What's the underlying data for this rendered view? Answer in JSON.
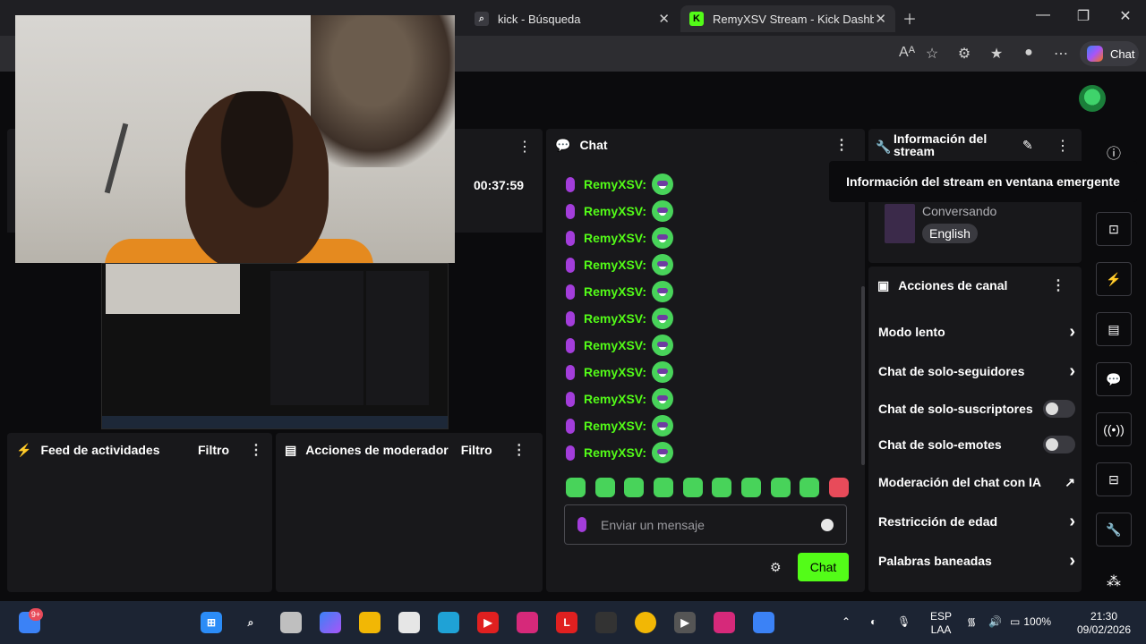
{
  "browser": {
    "tabs": [
      {
        "label": "kick - Búsqueda"
      },
      {
        "label": "RemyXSV Stream - Kick Dashboard"
      }
    ],
    "copilot_label": "Chat"
  },
  "dashboard": {
    "timer": "00:37:59",
    "feed": {
      "title": "Feed de actividades",
      "filter": "Filtro"
    },
    "mod_actions": {
      "title": "Acciones de moderador",
      "filter": "Filtro"
    },
    "chat": {
      "title": "Chat",
      "messages": [
        "RemyXSV:",
        "RemyXSV:",
        "RemyXSV:",
        "RemyXSV:",
        "RemyXSV:",
        "RemyXSV:",
        "RemyXSV:",
        "RemyXSV:",
        "RemyXSV:",
        "RemyXSV:",
        "RemyXSV:"
      ],
      "input_placeholder": "Enviar un mensaje",
      "send_label": "Chat"
    },
    "stream_info": {
      "title": "Información del stream",
      "category": "Conversando",
      "language": "English",
      "tooltip": "Información del stream en ventana emergente"
    },
    "channel_actions": {
      "title": "Acciones de canal",
      "items": [
        {
          "label": "Modo lento",
          "control": "chevron"
        },
        {
          "label": "Chat de solo-seguidores",
          "control": "chevron"
        },
        {
          "label": "Chat de solo-suscriptores",
          "control": "toggle",
          "enabled": false
        },
        {
          "label": "Chat de solo-emotes",
          "control": "toggle",
          "enabled": false
        },
        {
          "label": "Moderación del chat con IA",
          "control": "external"
        },
        {
          "label": "Restricción de edad",
          "control": "chevron"
        },
        {
          "label": "Palabras baneadas",
          "control": "chevron"
        }
      ]
    }
  },
  "taskbar": {
    "notification_badge": "9+",
    "language": "ESP",
    "language_sub": "LAA",
    "battery": "100%",
    "time": "21:30",
    "date": "09/02/2026"
  },
  "colors": {
    "kick_green": "#53fc18",
    "panel_bg": "#18181b",
    "page_bg": "#0b0b0d"
  }
}
